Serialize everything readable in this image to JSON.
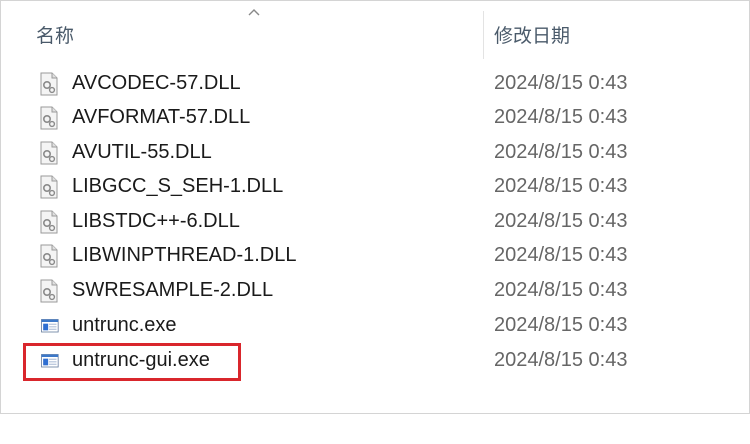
{
  "header": {
    "name_label": "名称",
    "date_label": "修改日期"
  },
  "files": [
    {
      "name": "AVCODEC-57.DLL",
      "date": "2024/8/15 0:43",
      "icon": "dll-icon"
    },
    {
      "name": "AVFORMAT-57.DLL",
      "date": "2024/8/15 0:43",
      "icon": "dll-icon"
    },
    {
      "name": "AVUTIL-55.DLL",
      "date": "2024/8/15 0:43",
      "icon": "dll-icon"
    },
    {
      "name": "LIBGCC_S_SEH-1.DLL",
      "date": "2024/8/15 0:43",
      "icon": "dll-icon"
    },
    {
      "name": "LIBSTDC++-6.DLL",
      "date": "2024/8/15 0:43",
      "icon": "dll-icon"
    },
    {
      "name": "LIBWINPTHREAD-1.DLL",
      "date": "2024/8/15 0:43",
      "icon": "dll-icon"
    },
    {
      "name": "SWRESAMPLE-2.DLL",
      "date": "2024/8/15 0:43",
      "icon": "dll-icon"
    },
    {
      "name": "untrunc.exe",
      "date": "2024/8/15 0:43",
      "icon": "exe-icon"
    },
    {
      "name": "untrunc-gui.exe",
      "date": "2024/8/15 0:43",
      "icon": "exe-icon"
    }
  ],
  "highlight_color": "#d9262c"
}
